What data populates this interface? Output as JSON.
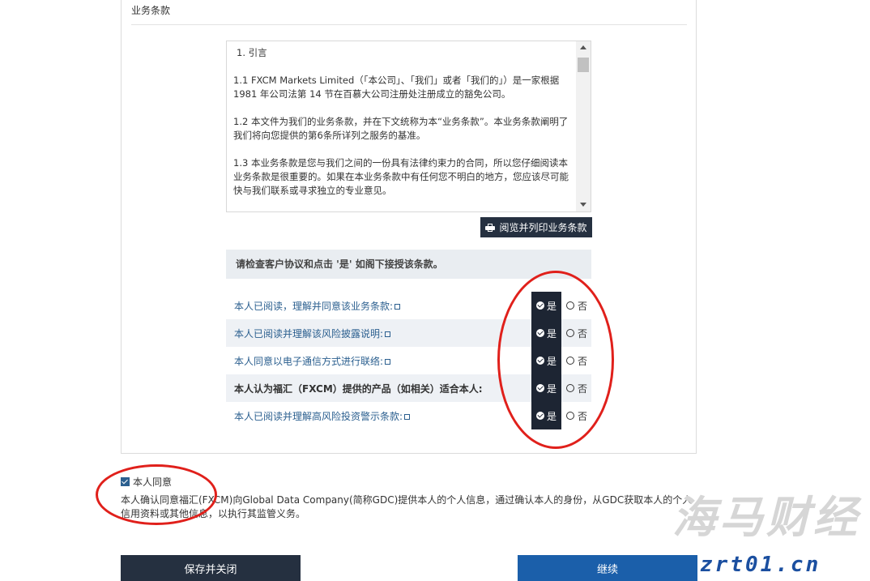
{
  "section": {
    "title": "业务条款"
  },
  "terms": {
    "heading": "1. 引言",
    "paragraphs": [
      "1.1 FXCM Markets Limited（「本公司」、「我们」或者「我们的」）是一家根据 1981 年公司法第 14 节在百慕大公司注册处注册成立的豁免公司。",
      "1.2 本文件为我们的业务条款，并在下文统称为本“业务条款”。本业务条款阐明了我们将向您提供的第6条所详列之服务的基准。",
      "1.3 本业务条款是您与我们之间的一份具有法律约束力的合同，所以您仔细阅读本业务条款是很重要的。如果在本业务条款中有任何您不明白的地方，您应该尽可能快与我们联系或寻求独立的专业意见。"
    ]
  },
  "print_button": {
    "label": "阅览并列印业务条款",
    "icon": "printer-icon"
  },
  "notice": "请检查客户协议和点击 '是' 如阁下接授该条款。",
  "rows": [
    {
      "label": "本人已阅读，理解并同意该业务条款:",
      "link": true
    },
    {
      "label": "本人已阅读并理解该风险披露说明:",
      "link": true
    },
    {
      "label": "本人同意以电子通信方式进行联络:",
      "link": true
    },
    {
      "label": "本人认为福汇（FXCM）提供的产品（如相关）适合本人:",
      "link": false
    },
    {
      "label": "本人已阅读并理解高风险投资警示条款:",
      "link": true
    }
  ],
  "options": {
    "yes": "是",
    "no": "否"
  },
  "consent": {
    "label": "本人同意",
    "checked": true,
    "text": "本人确认同意福汇(FXCM)向Global Data Company(简称GDC)提供本人的个人信息，通过确认本人的身份，从GDC获取本人的个人信用资料或其他信息，以执行其监管义务。"
  },
  "buttons": {
    "save": "保存并关闭",
    "continue": "继续"
  },
  "watermark": {
    "brand": "海马财经",
    "site": "zrt01.cn"
  },
  "colors": {
    "dark": "#253040",
    "primary": "#1b5faa",
    "link": "#2b5f8f",
    "annotation": "#e0201b"
  }
}
